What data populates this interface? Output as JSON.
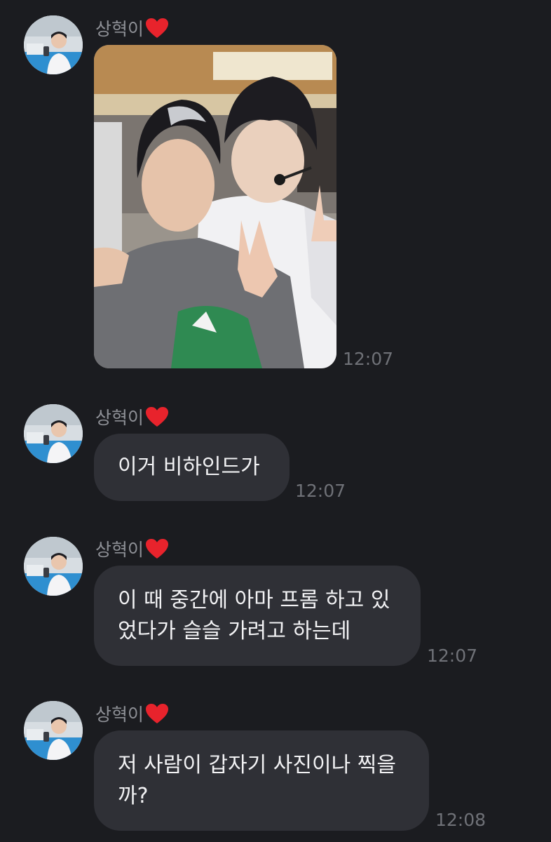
{
  "chat": {
    "messages": [
      {
        "sender": "상혁이",
        "type": "photo",
        "time": "12:07",
        "icon": "heart-icon"
      },
      {
        "sender": "상혁이",
        "type": "text",
        "text_lines": [
          "이거 비하인드가"
        ],
        "time": "12:07"
      },
      {
        "sender": "상혁이",
        "type": "text",
        "text_lines": [
          "이 때 중간에 아마 프롬 하고 있",
          "었다가 슬슬 가려고 하는데"
        ],
        "time": "12:07"
      },
      {
        "sender": "상혁이",
        "type": "text",
        "text_lines": [
          "저 사람이 갑자기 사진이나 찍을",
          "까?"
        ],
        "time": "12:08"
      }
    ]
  },
  "colors": {
    "background": "#1b1c20",
    "bubble": "#2f3036",
    "bubble_text": "#f2f2f4",
    "sender_text": "#8e9096",
    "time_text": "#6f7177",
    "heart": "#e8232c"
  }
}
